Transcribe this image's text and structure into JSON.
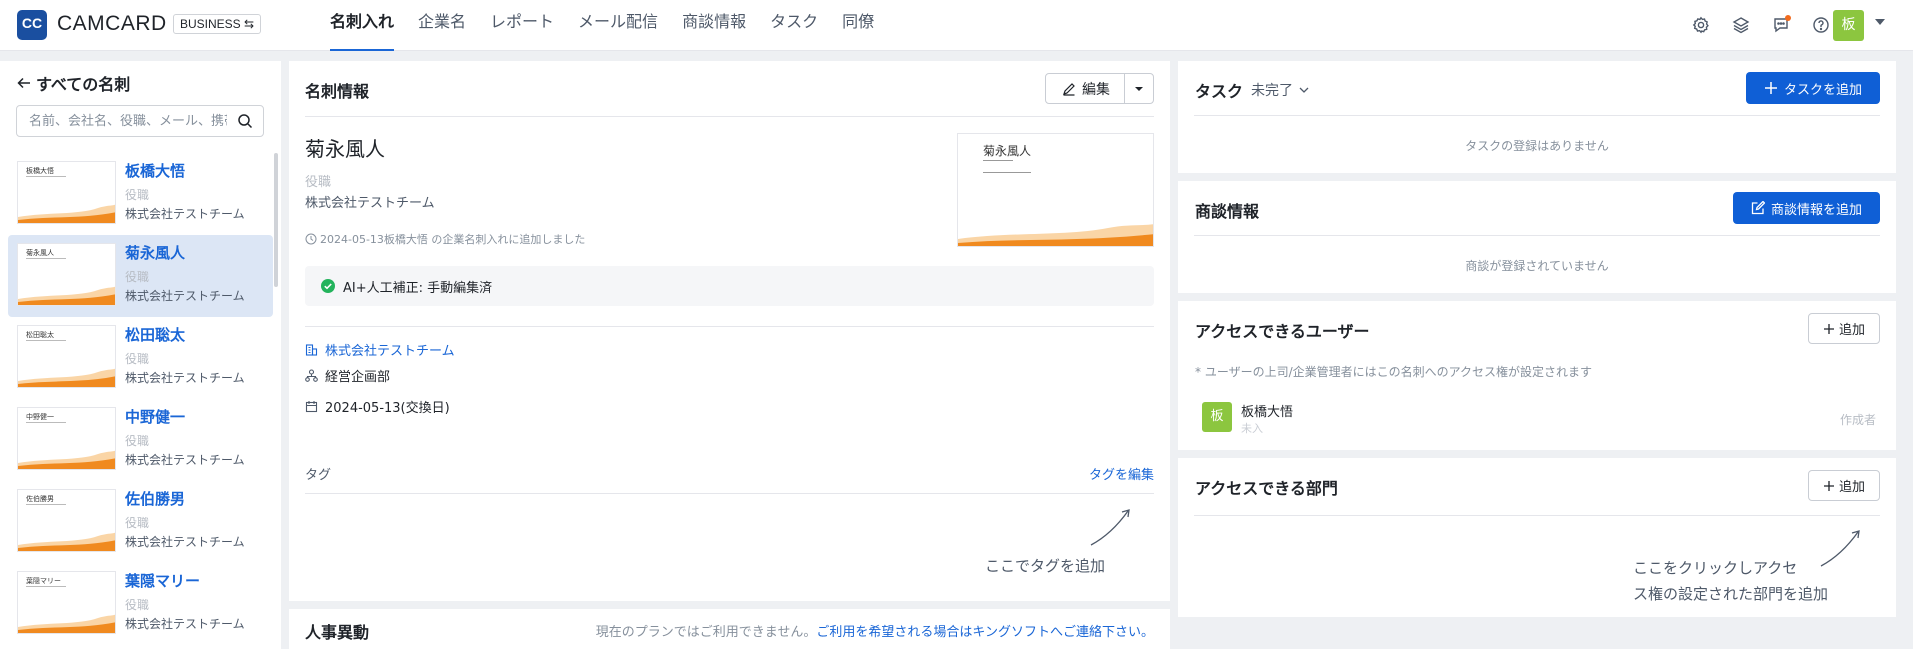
{
  "app": {
    "logo_mark": "CC",
    "logo_text": "CAMCARD",
    "edition": "BUSINESS ⇆"
  },
  "nav": [
    {
      "label": "名刺入れ",
      "active": true
    },
    {
      "label": "企業名"
    },
    {
      "label": "レポート"
    },
    {
      "label": "メール配信"
    },
    {
      "label": "商談情報"
    },
    {
      "label": "タスク"
    },
    {
      "label": "同僚"
    }
  ],
  "topbar": {
    "icons": [
      "gear-icon",
      "layers-icon",
      "chat-icon",
      "help-icon"
    ],
    "avatar_initial": "板"
  },
  "sidebar": {
    "back_label": "すべての名刺",
    "search_placeholder": "名前、会社名、役職、メール、携帯",
    "cards": [
      {
        "name": "板橋大悟",
        "title": "役職",
        "company": "株式会社テストチーム"
      },
      {
        "name": "菊永風人",
        "title": "役職",
        "company": "株式会社テストチーム",
        "selected": true
      },
      {
        "name": "松田聡太",
        "title": "役職",
        "company": "株式会社テストチーム"
      },
      {
        "name": "中野健一",
        "title": "役職",
        "company": "株式会社テストチーム"
      },
      {
        "name": "佐伯勝男",
        "title": "役職",
        "company": "株式会社テストチーム"
      },
      {
        "name": "葉隠マリー",
        "title": "役職",
        "company": "株式会社テストチーム"
      }
    ]
  },
  "detail": {
    "header": "名刺情報",
    "edit_label": "編集",
    "name": "菊永風人",
    "title": "役職",
    "company": "株式会社テストチーム",
    "added_note": "2024-05-13板橋大悟 の企業名刺入れに追加しました",
    "ai_status": "AI+人工補正: 手動編集済",
    "company_link": "株式会社テストチーム",
    "department": "経営企画部",
    "exchange_date": "2024-05-13(交換日)",
    "tag_label": "タグ",
    "tag_edit": "タグを編集",
    "tag_hint": "ここでタグを追加"
  },
  "personnel": {
    "title": "人事異動",
    "note": "現在のプランではご利用できません。",
    "note_link": "ご利用を希望される場合はキングソフトへご連絡下さい。"
  },
  "tasks": {
    "title": "タスク",
    "filter": "未完了",
    "add_label": "タスクを追加",
    "empty": "タスクの登録はありません"
  },
  "deals": {
    "title": "商談情報",
    "add_label": "商談情報を追加",
    "empty": "商談が登録されていません"
  },
  "access_users": {
    "title": "アクセスできるユーザー",
    "add_label": "追加",
    "note": "* ユーザーの上司/企業管理者にはこの名刺へのアクセス権が設定されます",
    "user_initial": "板",
    "user_name": "板橋大悟",
    "user_sub": "未入",
    "user_role": "作成者"
  },
  "access_depts": {
    "title": "アクセスできる部門",
    "add_label": "追加",
    "hint_line1": "ここをクリックしアクセ",
    "hint_line2": "ス権の設定された部門を追加"
  },
  "colors": {
    "primary": "#0f5fd6",
    "link": "#1a66d6",
    "avatar": "#8cc63f",
    "card_wave": "#f5a23a"
  }
}
